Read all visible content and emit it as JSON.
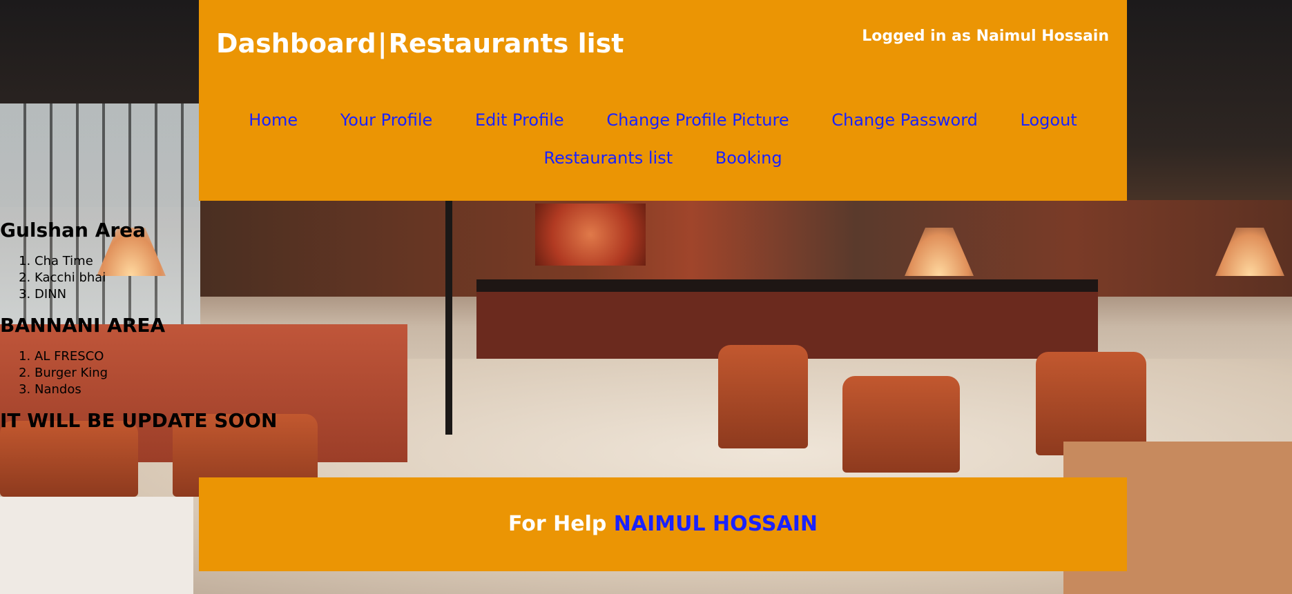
{
  "header": {
    "title_left": "Dashboard",
    "title_separator": "|",
    "title_right": "Restaurants list",
    "login_text": "Logged in as Naimul Hossain"
  },
  "nav": {
    "row1": [
      "Home",
      "Your Profile",
      "Edit Profile",
      "Change Profile Picture",
      "Change Password",
      "Logout"
    ],
    "row2": [
      "Restaurants list",
      "Booking"
    ]
  },
  "sections": [
    {
      "heading": "Gulshan Area",
      "items": [
        "Cha Time",
        "Kacchi bhai",
        "DINN"
      ]
    },
    {
      "heading": "BANNANI AREA",
      "items": [
        "AL FRESCO",
        "Burger King",
        "Nandos"
      ]
    }
  ],
  "notice": "IT WILL BE UPDATE SOON",
  "footer": {
    "prefix": "For Help",
    "name": "NAIMUL HOSSAIN"
  },
  "colors": {
    "panel": "#eb9504",
    "link": "#1a22ff",
    "panel_text": "#ffffff"
  }
}
